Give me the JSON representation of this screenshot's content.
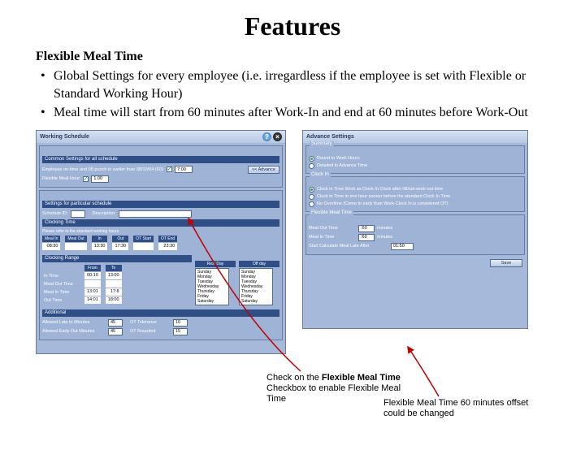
{
  "title": "Features",
  "subtitle": "Flexible Meal Time",
  "bullets": [
    "Global Settings for every employee (i.e. irregardless if the employee is set with Flexible or Standard Working Hour)",
    "Meal time will start from 60 minutes after Work-In and end at 60 minutes before Work-Out"
  ],
  "left": {
    "header": "Working Schedule",
    "common_hdr": "Common Settings for all schedule",
    "early_label": "Employee on-time and (if) punch in earlier than 08/10/04 (60):",
    "early_val": "7:00",
    "flex_label": "Flexible Meal Hour:",
    "flex_chk": true,
    "flex_val": "1.00",
    "show_btn": "<< Advance",
    "particular_hdr": "Settings for particular schedule",
    "schedule_id_lbl": "Schedule ID:",
    "schedule_id_val": "",
    "description_lbl": "Description:",
    "description_val": "",
    "clocking_time_hdr": "Clocking Time",
    "clocking_sub": "Please refer to the standard working hours",
    "cols": [
      "Meal In",
      "Meal Out",
      "In",
      "Out",
      "OT Start",
      "OT End"
    ],
    "vals": [
      "08:30",
      "",
      "13:30",
      "17:30",
      "",
      "23:30"
    ],
    "clocking_range_hdr": "Clocking Range",
    "range_rows": [
      "In Time",
      "Meal Out Time",
      "Meal In Time",
      "Out Time"
    ],
    "range_from": [
      "00:10",
      "",
      "13:01",
      "14:01"
    ],
    "range_to": [
      "13:00",
      "",
      "17:8",
      "18:00"
    ],
    "restday_hdr": "Rest Day",
    "restdays": [
      "Sunday",
      "Monday",
      "Tuesday",
      "Wednesday",
      "Thursday",
      "Friday",
      "Saturday"
    ],
    "offday_hdr": "Off day",
    "offdays": [
      "Sunday",
      "Monday",
      "Tuesday",
      "Wednesday",
      "Thursday",
      "Friday",
      "Saturday"
    ],
    "additional_hdr": "Additional",
    "add_rows": [
      [
        "Allowed Late In Minutes",
        "45",
        "OT Tolerance",
        "10"
      ],
      [
        "Allowed Early Out Minutes",
        "45",
        "OT Rounded",
        "15"
      ]
    ]
  },
  "right": {
    "header": "Advance Settings",
    "summary_hdr": "Summary",
    "rad1": "Round to Work Hours",
    "rad2": "Detailed in Advance Time",
    "clockin_hdr": "Clock In",
    "clk1": "Clock in Time Work as Clock In Clock after 08/set-work-out time",
    "clk2": "Clock in Time in one hour sooner before the standard Clock In Time",
    "clk3": "No Overtime (Come to early than Work-Clock In is considered OT)",
    "flex_hdr": "Flexible Meal Time",
    "after_lbl": "Meal Out Time",
    "after_val": ":60",
    "after_unit": "minutes",
    "before_lbl": "Meal In Time",
    "before_val": ":60",
    "before_unit": "minutes",
    "start_lbl": "Start Calculate Meal Late After",
    "start_val": "01:50",
    "save_btn": "Save"
  },
  "annot1": {
    "l1": "Check on the ",
    "b": "Flexible Meal Time",
    "l2": "Checkbox to enable Flexible Meal",
    "l3": "Time"
  },
  "annot2": {
    "l1": "Flexible Meal Time 60 minutes offset",
    "l2": "could be changed"
  }
}
